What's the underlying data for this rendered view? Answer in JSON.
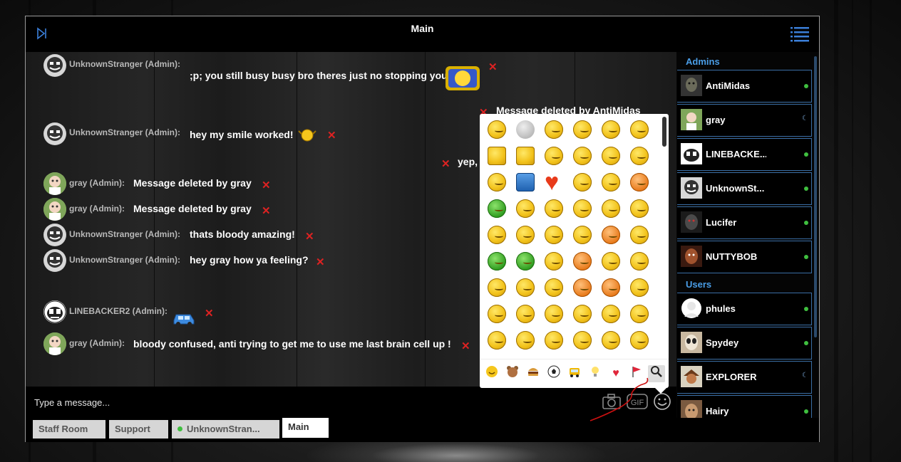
{
  "window": {
    "title": "Main"
  },
  "messages": [
    {
      "user": "UnknownStranger (Admin):",
      "text": ";p; you still busy busy bro theres just no stopping you",
      "avatar": "smiley-avatar"
    },
    {
      "user": "",
      "text": "Message deleted by AntiMidas",
      "avatar": ""
    },
    {
      "user": "UnknownStranger (Admin):",
      "text": "hey my smile worked!",
      "avatar": "smiley-avatar"
    },
    {
      "user": "",
      "text": "yep,",
      "avatar": ""
    },
    {
      "user": "gray (Admin):",
      "text": "Message deleted by gray",
      "avatar": "old-man-avatar"
    },
    {
      "user": "gray (Admin):",
      "text": "Message deleted by gray",
      "avatar": "old-man-avatar"
    },
    {
      "user": "UnknownStranger (Admin):",
      "text": "thats bloody amazing!",
      "avatar": "smiley-avatar"
    },
    {
      "user": "UnknownStranger (Admin):",
      "text": "hey gray how ya feeling?",
      "avatar": "smiley-avatar"
    },
    {
      "user": "LINEBACKER2 (Admin):",
      "text": "",
      "avatar": "cartoon-avatar"
    },
    {
      "user": "gray (Admin):",
      "text": "bloody confused, anti trying to get me to use me last brain cell up !",
      "avatar": "old-man-avatar"
    }
  ],
  "input": {
    "placeholder": "Type a message..."
  },
  "tabs": [
    {
      "label": "Staff Room"
    },
    {
      "label": "Support"
    },
    {
      "label": "UnknownStran..."
    },
    {
      "label": "Main"
    }
  ],
  "sidebar": {
    "admins_heading": "Admins",
    "users_heading": "Users",
    "admins": [
      {
        "name": "AntiMidas",
        "status": "online"
      },
      {
        "name": "gray",
        "status": "away"
      },
      {
        "name": "LINEBACKE...",
        "status": "online"
      },
      {
        "name": "UnknownSt...",
        "status": "online"
      },
      {
        "name": "Lucifer",
        "status": "online"
      },
      {
        "name": "NUTTYBOB",
        "status": "online"
      }
    ],
    "users": [
      {
        "name": "phules",
        "status": "online"
      },
      {
        "name": "Spydey",
        "status": "online"
      },
      {
        "name": "EXPLORER",
        "status": "away"
      },
      {
        "name": "Hairy",
        "status": "online"
      }
    ]
  },
  "emoji_panel": {
    "categories": [
      "smiley",
      "animal",
      "food",
      "sport",
      "travel",
      "object",
      "heart",
      "flag",
      "search"
    ],
    "selected_category": "search"
  },
  "colors": {
    "accent": "#4a9ee8",
    "online": "#3fbf3f",
    "delete": "#d22222",
    "annotation": "#cc1111"
  }
}
